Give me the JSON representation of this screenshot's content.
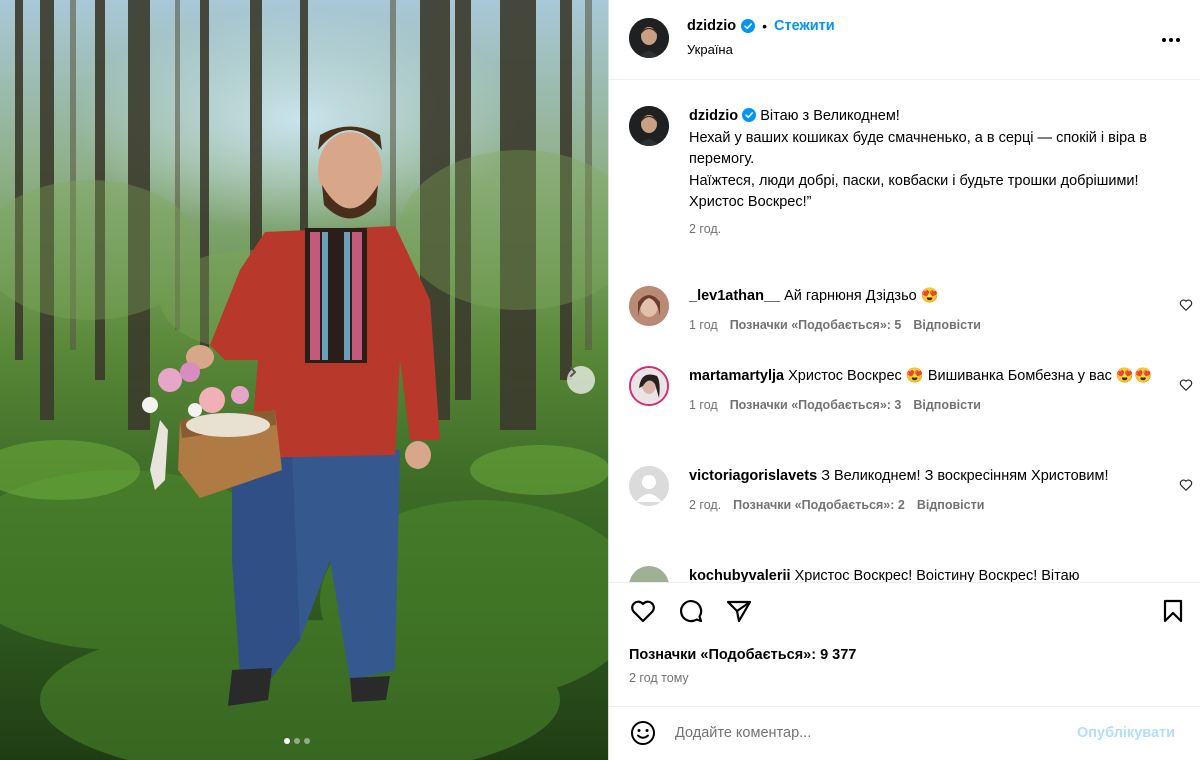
{
  "post": {
    "username": "dzidzio",
    "follow_label": "Стежити",
    "location": "Україна",
    "separator": "•"
  },
  "caption": {
    "username": "dzidzio",
    "lines": [
      "Вітаю з Великоднем!",
      "Нехай у ваших кошиках буде смачненько, а в серці — спокій і віра в перемогу.",
      "Наїжтеся, люди добрі, паски, ковбаски і будьте трошки добрішими!",
      "Христос Воскрес!”"
    ],
    "time": "2 год."
  },
  "comments": [
    {
      "username": "_lev1athan__",
      "text": "Ай гарнюня Дзідзьо 😍",
      "time": "1 год",
      "likes": "Позначки «Подобається»: 5",
      "reply": "Відповісти"
    },
    {
      "username": "martamartylja",
      "text": "Христос Воскрес 😍 Вишиванка Бомбезна у вас 😍😍",
      "time": "1 год",
      "likes": "Позначки «Подобається»: 3",
      "reply": "Відповісти"
    },
    {
      "username": "victoriagorislavets",
      "text": "З Великоднем! З воскресінням Христовим!",
      "time": "2 год.",
      "likes": "Позначки «Подобається»: 2",
      "reply": "Відповісти"
    },
    {
      "username": "kochubyvalerii",
      "text": "Христос Воскрес! Воістину Воскрес! Вітаю",
      "time": "",
      "likes": "",
      "reply": ""
    }
  ],
  "footer": {
    "likes": "Позначки «Подобається»: 9 377",
    "posted": "2 год тому",
    "comment_placeholder": "Додайте коментар...",
    "publish_label": "Опублікувати"
  },
  "carousel": {
    "current": 1,
    "total": 3
  },
  "colors": {
    "accent": "#0095f6",
    "muted": "#737373",
    "publish_disabled": "#b2dffc"
  },
  "icons": [
    "verified-icon",
    "more-icon",
    "heart-icon",
    "comment-icon",
    "share-icon",
    "bookmark-icon",
    "emoji-icon",
    "chevron-right-icon"
  ]
}
